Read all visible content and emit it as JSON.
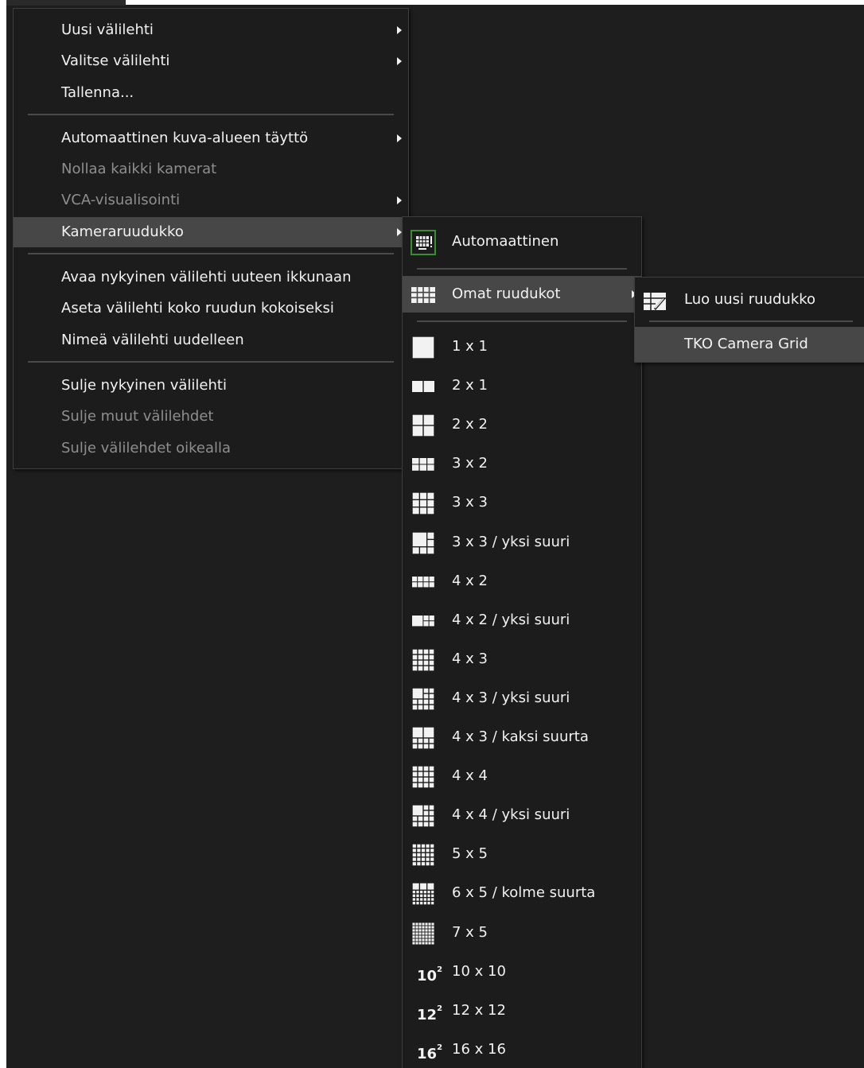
{
  "main_menu": {
    "items": [
      {
        "label": "Uusi välilehti",
        "submenu": true,
        "disabled": false,
        "highlighted": false
      },
      {
        "label": "Valitse välilehti",
        "submenu": true,
        "disabled": false,
        "highlighted": false
      },
      {
        "label": "Tallenna...",
        "submenu": false,
        "disabled": false,
        "highlighted": false
      },
      {
        "label": "Automaattinen kuva-alueen täyttö",
        "submenu": true,
        "disabled": false,
        "highlighted": false
      },
      {
        "label": "Nollaa kaikki kamerat",
        "submenu": false,
        "disabled": true,
        "highlighted": false
      },
      {
        "label": "VCA-visualisointi",
        "submenu": true,
        "disabled": true,
        "highlighted": false
      },
      {
        "label": "Kameraruudukko",
        "submenu": true,
        "disabled": false,
        "highlighted": true
      },
      {
        "label": "Avaa nykyinen välilehti uuteen ikkunaan",
        "submenu": false,
        "disabled": false,
        "highlighted": false
      },
      {
        "label": "Aseta välilehti koko ruudun kokoiseksi",
        "submenu": false,
        "disabled": false,
        "highlighted": false
      },
      {
        "label": "Nimeä välilehti uudelleen",
        "submenu": false,
        "disabled": false,
        "highlighted": false
      },
      {
        "label": "Sulje nykyinen välilehti",
        "submenu": false,
        "disabled": false,
        "highlighted": false
      },
      {
        "label": "Sulje muut välilehdet",
        "submenu": false,
        "disabled": true,
        "highlighted": false
      },
      {
        "label": "Sulje välilehdet oikealla",
        "submenu": false,
        "disabled": true,
        "highlighted": false
      }
    ]
  },
  "grid_menu": {
    "automatic": {
      "label": "Automaattinen",
      "icon": "auto-grid-icon"
    },
    "custom": {
      "label": "Omat ruudukot",
      "icon": "custom-grids-icon",
      "highlighted": true
    },
    "layouts": [
      {
        "label": "1 x 1",
        "icon": "layout-1x1-icon"
      },
      {
        "label": "2 x 1",
        "icon": "layout-2x1-icon"
      },
      {
        "label": "2 x 2",
        "icon": "layout-2x2-icon"
      },
      {
        "label": "3 x 2",
        "icon": "layout-3x2-icon"
      },
      {
        "label": "3 x 3",
        "icon": "layout-3x3-icon"
      },
      {
        "label": "3 x 3 / yksi suuri",
        "icon": "layout-3x3-one-large-icon"
      },
      {
        "label": "4 x 2",
        "icon": "layout-4x2-icon"
      },
      {
        "label": "4 x 2 / yksi suuri",
        "icon": "layout-4x2-one-large-icon"
      },
      {
        "label": "4 x 3",
        "icon": "layout-4x3-icon"
      },
      {
        "label": "4 x 3 / yksi suuri",
        "icon": "layout-4x3-one-large-icon"
      },
      {
        "label": "4 x 3 / kaksi suurta",
        "icon": "layout-4x3-two-large-icon"
      },
      {
        "label": "4 x 4",
        "icon": "layout-4x4-icon"
      },
      {
        "label": "4 x 4 / yksi suuri",
        "icon": "layout-4x4-one-large-icon"
      },
      {
        "label": "5 x 5",
        "icon": "layout-5x5-icon"
      },
      {
        "label": "6 x 5 / kolme suurta",
        "icon": "layout-6x5-three-large-icon"
      },
      {
        "label": "7 x 5",
        "icon": "layout-7x5-icon"
      },
      {
        "label": "10 x 10",
        "icon": "layout-10x10-icon",
        "badge_base": "10",
        "badge_exp": "2"
      },
      {
        "label": "12 x 12",
        "icon": "layout-12x12-icon",
        "badge_base": "12",
        "badge_exp": "2"
      },
      {
        "label": "16 x 16",
        "icon": "layout-16x16-icon",
        "badge_base": "16",
        "badge_exp": "2"
      }
    ]
  },
  "custom_menu": {
    "items": [
      {
        "label": "Luo uusi ruudukko",
        "icon": "new-grid-icon",
        "highlighted": false
      },
      {
        "label": "TKO Camera Grid",
        "icon": "",
        "highlighted": true
      }
    ]
  },
  "colors": {
    "background": "#1e1e1e",
    "menu": "#1c1c1c",
    "highlight": "#474747",
    "text": "#f2f2f2",
    "disabled_text": "#8e8e8e",
    "accent_green": "#3c8c32"
  }
}
